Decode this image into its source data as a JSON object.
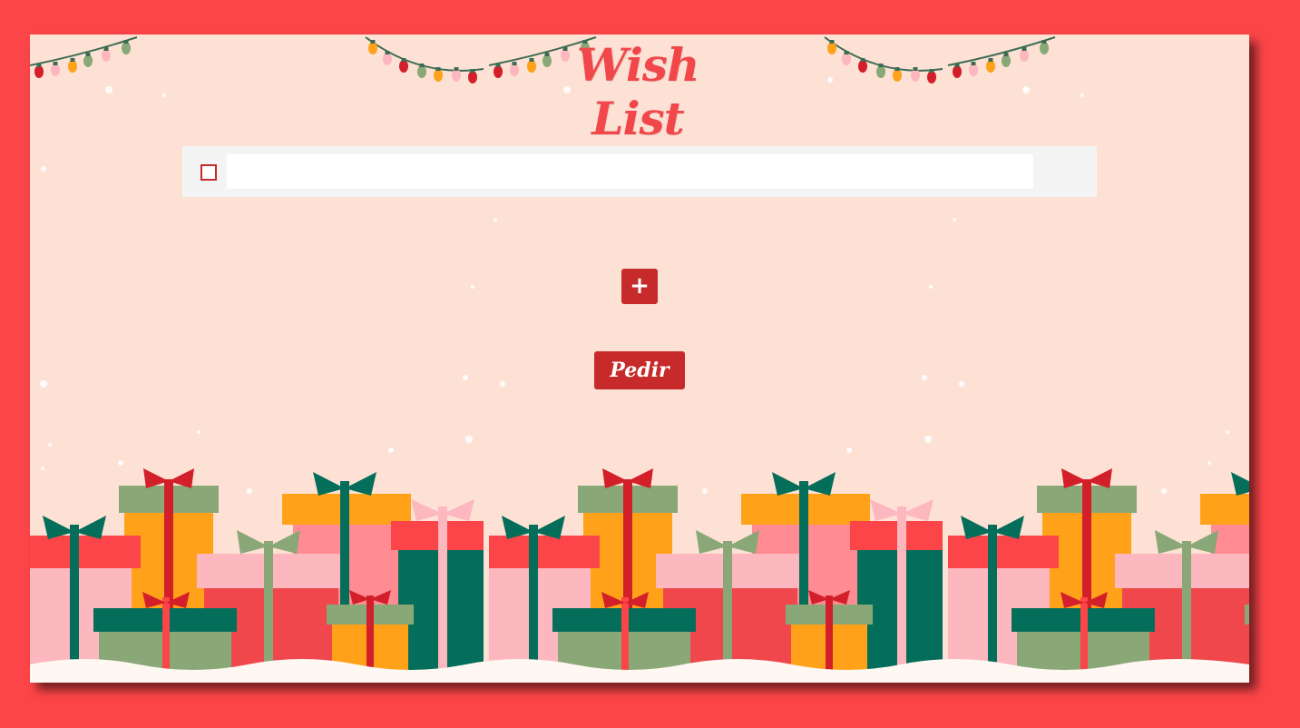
{
  "page": {
    "title": "Wish List"
  },
  "wish_item": {
    "checked": false,
    "value": ""
  },
  "actions": {
    "add_label": "+",
    "submit_label": "Pedir"
  },
  "colors": {
    "page_background": "#fc4548",
    "card_background": "#fde1d4",
    "accent_red": "#c62a2a",
    "title_color": "#f1474b",
    "row_background": "#f4f4f4"
  },
  "decorations": {
    "top_icon": "christmas-lights-garland-icon",
    "bottom_icon": "gift-boxes-pile-icon",
    "background_icon": "snowflakes-icon"
  }
}
